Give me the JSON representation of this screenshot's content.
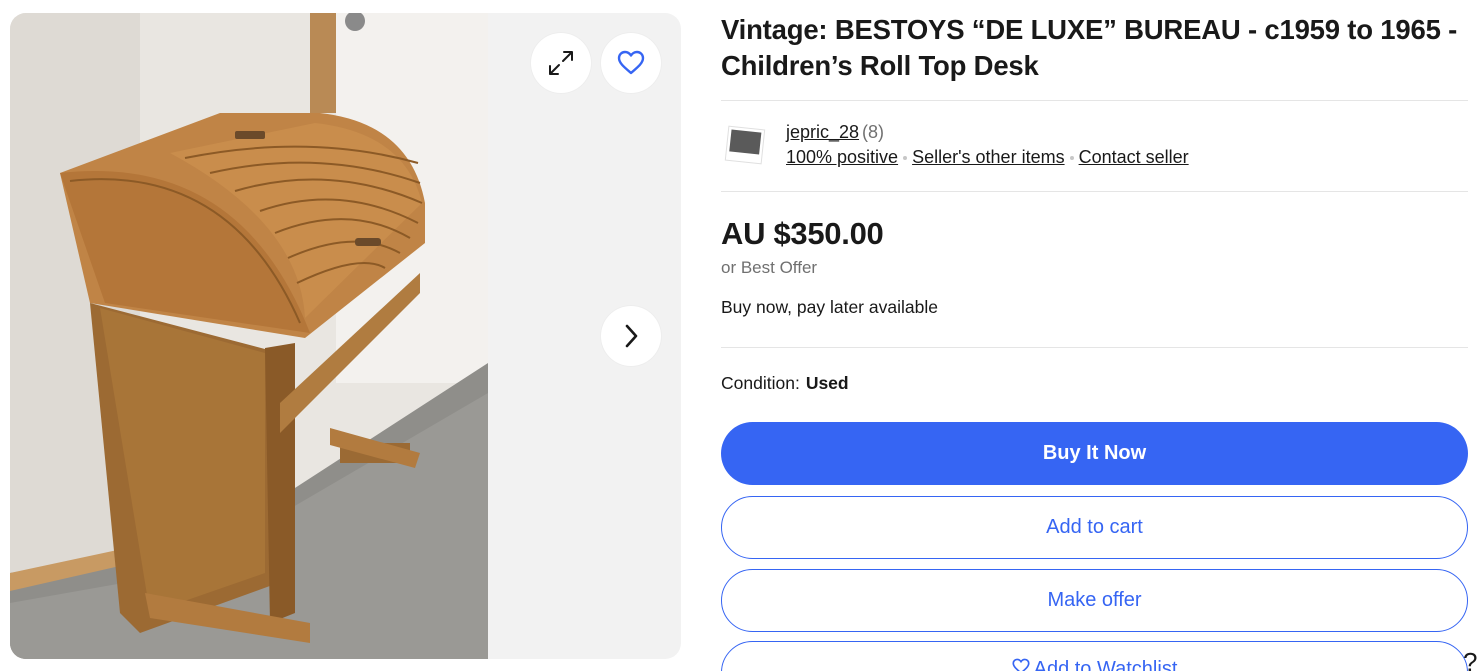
{
  "listing": {
    "title": "Vintage: BESTOYS “DE LUXE” BUREAU - c1959 to 1965 - Children’s Roll Top Desk"
  },
  "gallery": {
    "expand_icon": "expand-icon",
    "watch_icon": "heart-icon",
    "next_icon": "chevron-right-icon"
  },
  "seller": {
    "name": "jepric_28",
    "feedback_count": "(8)",
    "positive": "100% positive",
    "other_items": "Seller's other items",
    "contact": "Contact seller"
  },
  "pricing": {
    "price": "AU $350.00",
    "best_offer": "or Best Offer",
    "pay_later": "Buy now, pay later available"
  },
  "condition": {
    "label": "Condition:",
    "value": "Used"
  },
  "actions": {
    "buy_now": "Buy It Now",
    "add_to_cart": "Add to cart",
    "make_offer": "Make offer",
    "watchlist": "Add to Watchlist"
  },
  "help": {
    "label": "?"
  },
  "colors": {
    "accent": "#3665f3",
    "text": "#191919",
    "muted": "#707070"
  }
}
